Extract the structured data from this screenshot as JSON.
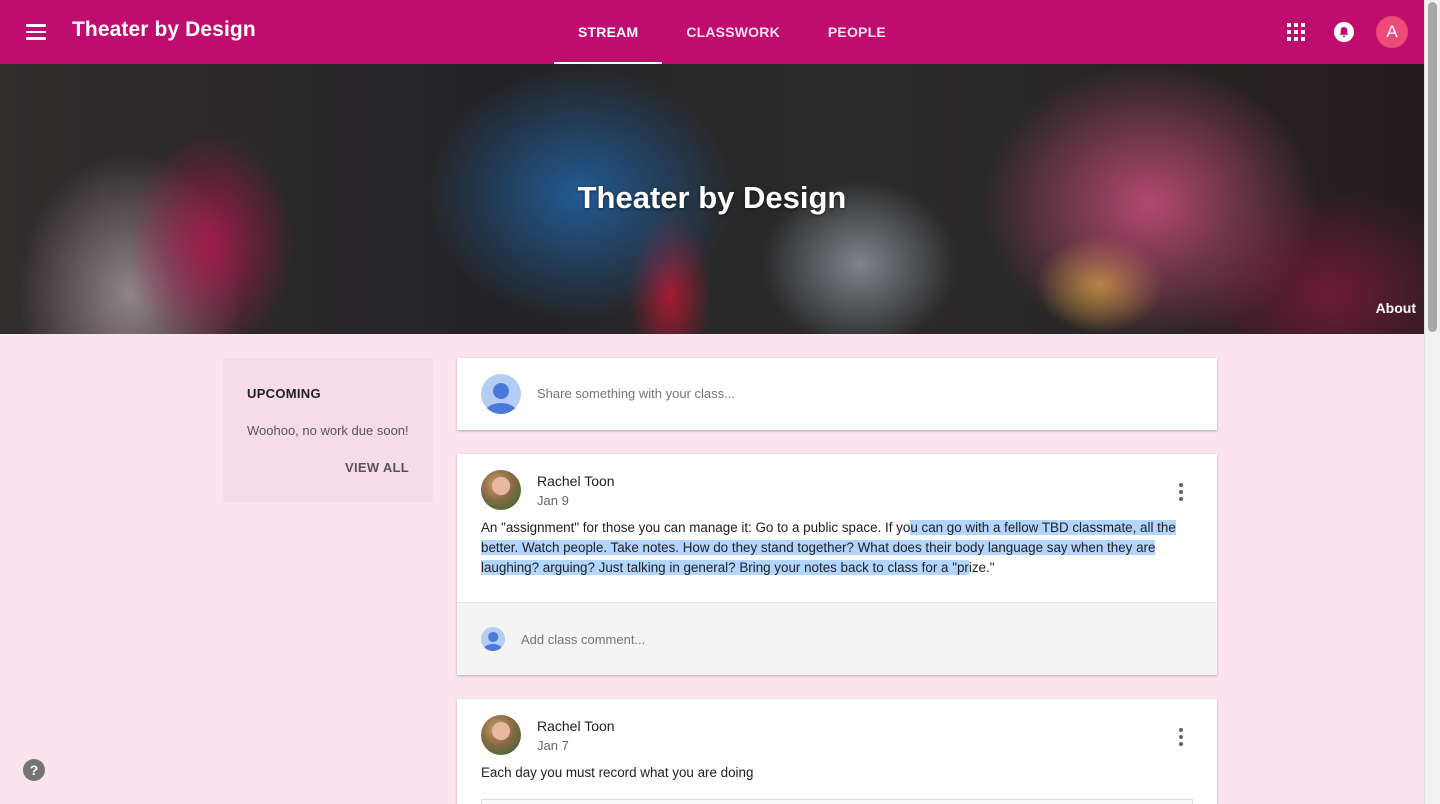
{
  "header": {
    "title": "Theater by Design",
    "tabs": [
      {
        "label": "STREAM",
        "active": true
      },
      {
        "label": "CLASSWORK",
        "active": false
      },
      {
        "label": "PEOPLE",
        "active": false
      }
    ],
    "avatar_letter": "A",
    "icons": [
      "menu-icon",
      "apps-icon",
      "notifications-icon"
    ]
  },
  "banner": {
    "title": "Theater by Design",
    "about_label": "About"
  },
  "upcoming": {
    "title": "UPCOMING",
    "message": "Woohoo, no work due soon!",
    "view_all_label": "VIEW ALL"
  },
  "share": {
    "placeholder": "Share something with your class..."
  },
  "posts": [
    {
      "author": "Rachel Toon",
      "date": "Jan 9",
      "body_before_selection": "An \"assignment\" for those you can manage it: Go to a public space. If yo",
      "body_selected": "u can go with a fellow TBD classmate, all the better. Watch people. Take notes. How do they stand together? What does their body language say when they are laughing? arguing? Just talking in general? Bring your notes back to class for a \"pr",
      "body_after_selection": "ize.\"",
      "comment_placeholder": "Add class comment..."
    },
    {
      "author": "Rachel Toon",
      "date": "Jan 7",
      "body": "Each day you must record what you are doing"
    }
  ],
  "colors": {
    "primary": "#bf0d6f",
    "background": "#fce4ef",
    "upcoming_bg": "#f8dbe9",
    "selection": "#b4d5fe"
  },
  "help_label": "?"
}
